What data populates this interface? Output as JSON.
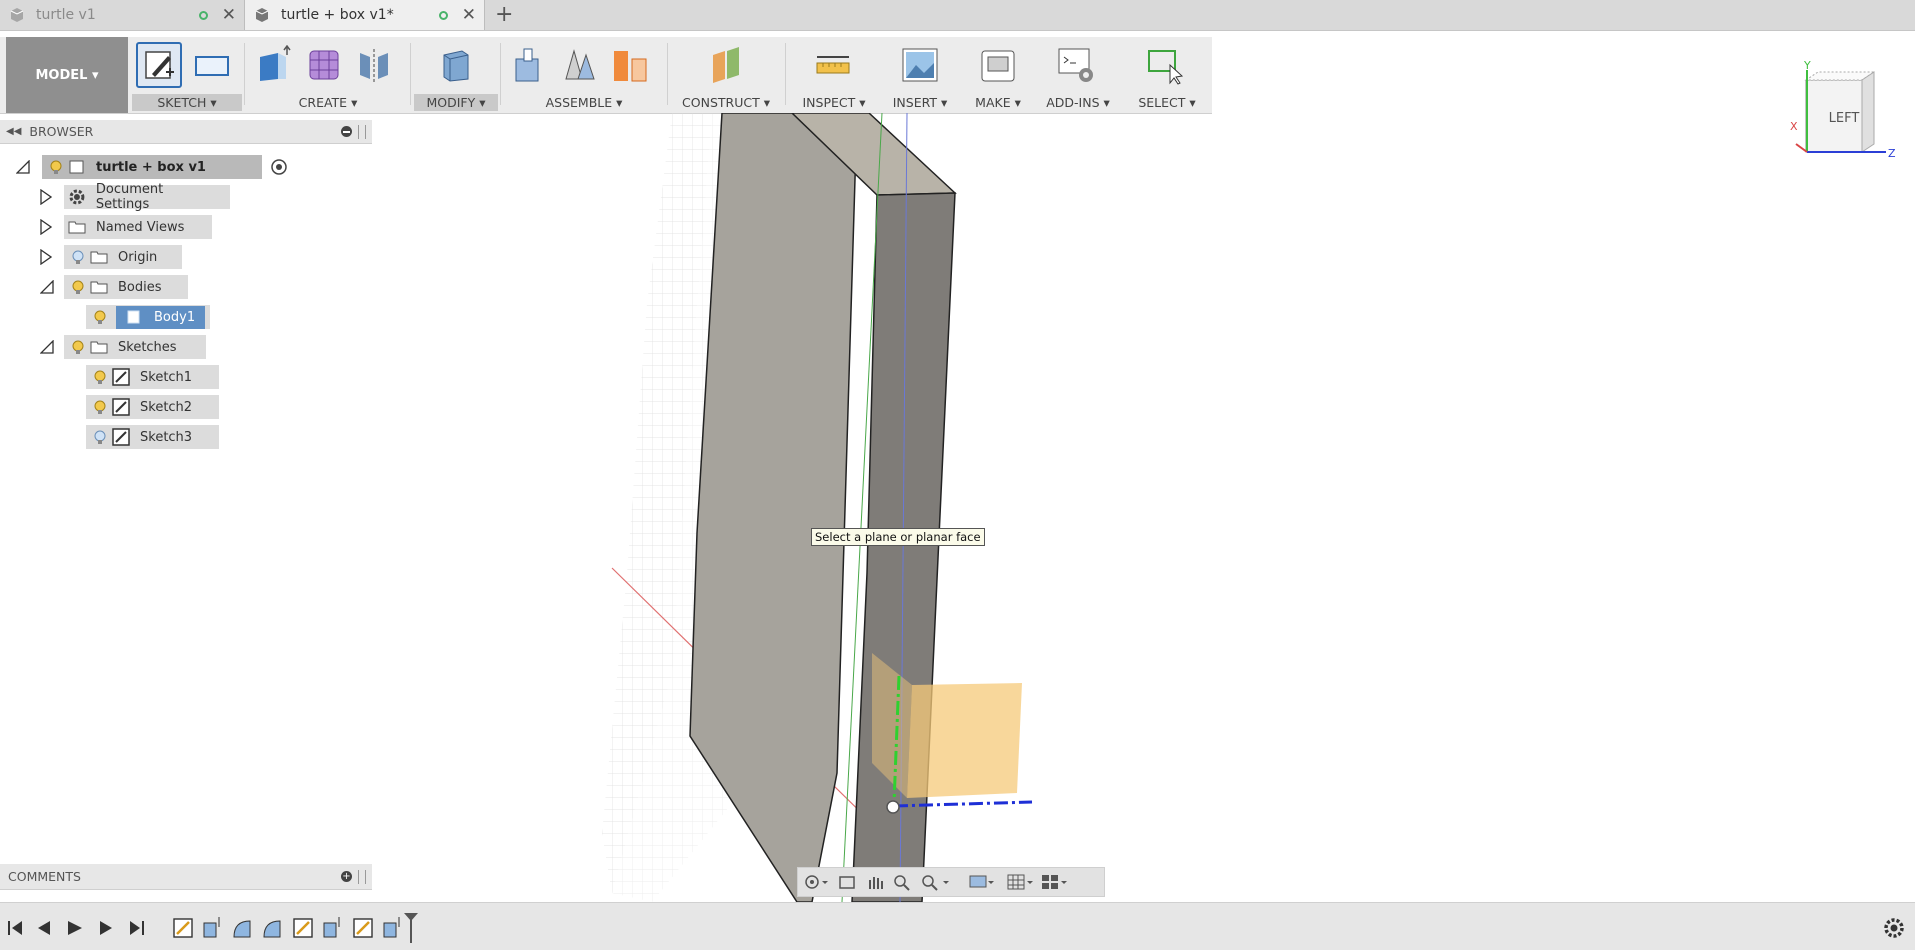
{
  "tabs": [
    {
      "label": "turtle v1",
      "active": false
    },
    {
      "label": "turtle + box v1*",
      "active": true
    }
  ],
  "toolbar": {
    "workspace": "MODEL",
    "groups": {
      "sketch": "SKETCH",
      "create": "CREATE",
      "modify": "MODIFY",
      "assemble": "ASSEMBLE",
      "construct": "CONSTRUCT",
      "inspect": "INSPECT",
      "insert": "INSERT",
      "make": "MAKE",
      "addins": "ADD-INS",
      "select": "SELECT"
    }
  },
  "browser": {
    "title": "BROWSER",
    "root": "turtle + box v1",
    "items": {
      "document_settings": "Document Settings",
      "named_views": "Named Views",
      "origin": "Origin",
      "bodies": "Bodies",
      "body1": "Body1",
      "sketches": "Sketches",
      "sketch1": "Sketch1",
      "sketch2": "Sketch2",
      "sketch3": "Sketch3"
    }
  },
  "viewport": {
    "tooltip": "Select a plane or planar face",
    "viewcube_face": "LEFT",
    "axes": {
      "x": "X",
      "y": "Y",
      "z": "Z"
    }
  },
  "comments": {
    "title": "COMMENTS"
  },
  "colors": {
    "accent": "#5f8fc4",
    "preview_plane": "#f6c97a",
    "x_axis": "#d94545",
    "y_axis": "#3fbf3f",
    "z_axis": "#2b3fd6"
  }
}
